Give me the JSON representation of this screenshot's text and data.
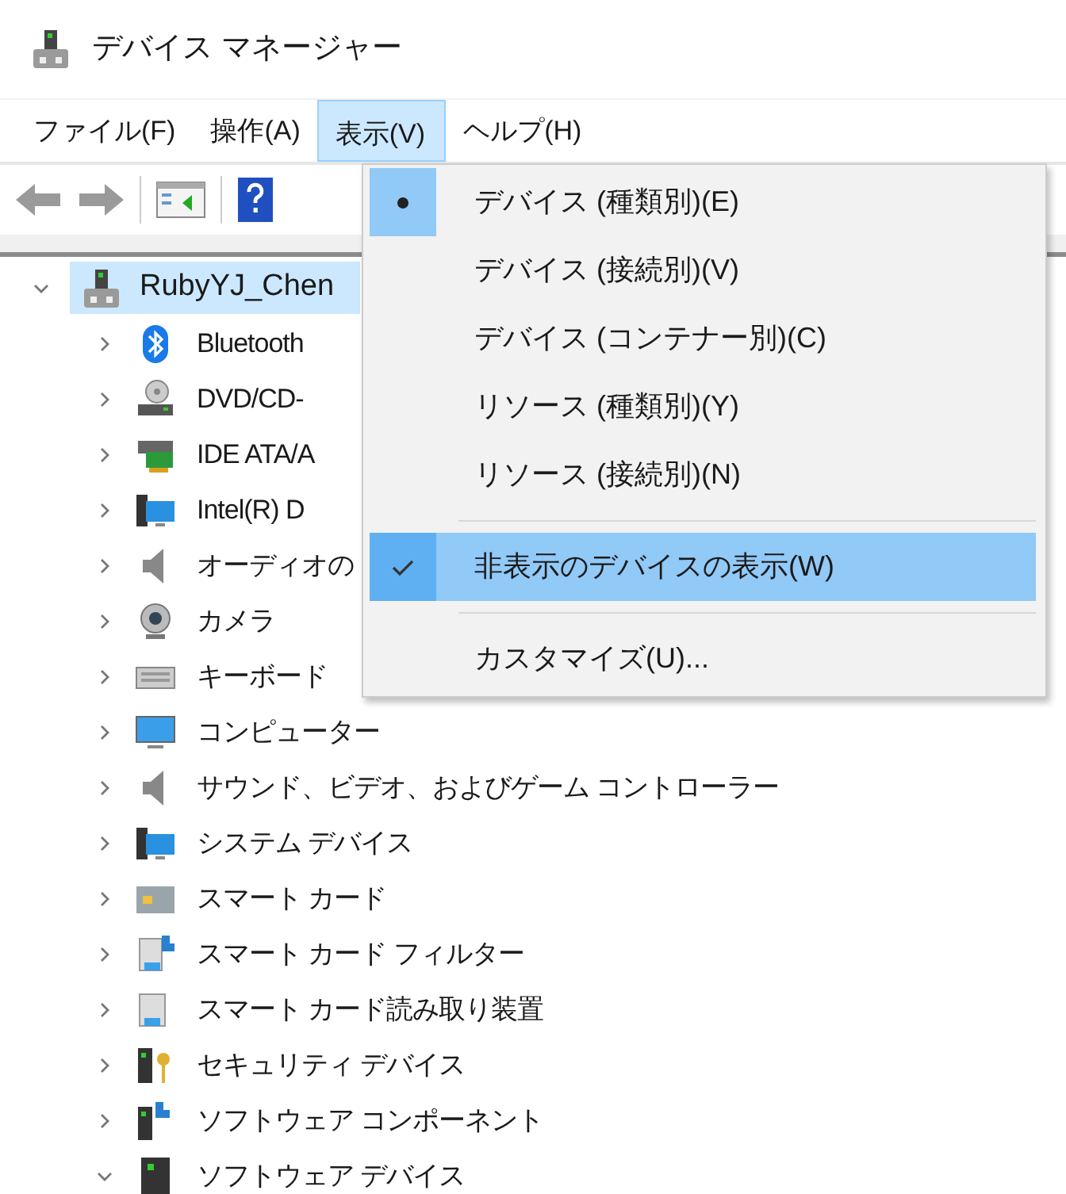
{
  "window": {
    "title": "デバイス マネージャー"
  },
  "menu_bar": [
    {
      "label": "ファイル(F)",
      "selected": false
    },
    {
      "label": "操作(A)",
      "selected": false
    },
    {
      "label": "表示(V)",
      "selected": true
    },
    {
      "label": "ヘルプ(H)",
      "selected": false
    }
  ],
  "tree": {
    "label": "RubyYJ_Chen",
    "selected": true,
    "expanded": true,
    "children": [
      {
        "label": "Bluetooth",
        "expanded": false
      },
      {
        "label": "DVD/CD-",
        "expanded": false
      },
      {
        "label": "IDE ATA/A",
        "expanded": false
      },
      {
        "label": "Intel(R) D",
        "expanded": false
      },
      {
        "label": "オーディオの",
        "expanded": false
      },
      {
        "label": "カメラ",
        "expanded": false
      },
      {
        "label": "キーボード",
        "expanded": false
      },
      {
        "label": "コンピューター",
        "expanded": false
      },
      {
        "label": "サウンド、ビデオ、およびゲーム コントローラー",
        "expanded": false
      },
      {
        "label": "システム デバイス",
        "expanded": false
      },
      {
        "label": "スマート カード",
        "expanded": false
      },
      {
        "label": "スマート カード フィルター",
        "expanded": false
      },
      {
        "label": "スマート カード読み取り装置",
        "expanded": false
      },
      {
        "label": "セキュリティ デバイス",
        "expanded": false
      },
      {
        "label": "ソフトウェア コンポーネント",
        "expanded": false
      },
      {
        "label": "ソフトウェア デバイス",
        "expanded": true
      }
    ]
  },
  "view_menu": [
    {
      "kind": "radio",
      "label": "デバイス (種類別)(E)",
      "selected": true
    },
    {
      "kind": "radio",
      "label": "デバイス (接続別)(V)",
      "selected": false
    },
    {
      "kind": "radio",
      "label": "デバイス (コンテナー別)(C)",
      "selected": false
    },
    {
      "kind": "radio",
      "label": "リソース (種類別)(Y)",
      "selected": false
    },
    {
      "kind": "radio",
      "label": "リソース (接続別)(N)",
      "selected": false
    },
    {
      "kind": "separator"
    },
    {
      "kind": "check",
      "label": "非表示のデバイスの表示(W)",
      "checked": true
    },
    {
      "kind": "separator"
    },
    {
      "kind": "command",
      "label": "カスタマイズ(U)..."
    }
  ]
}
